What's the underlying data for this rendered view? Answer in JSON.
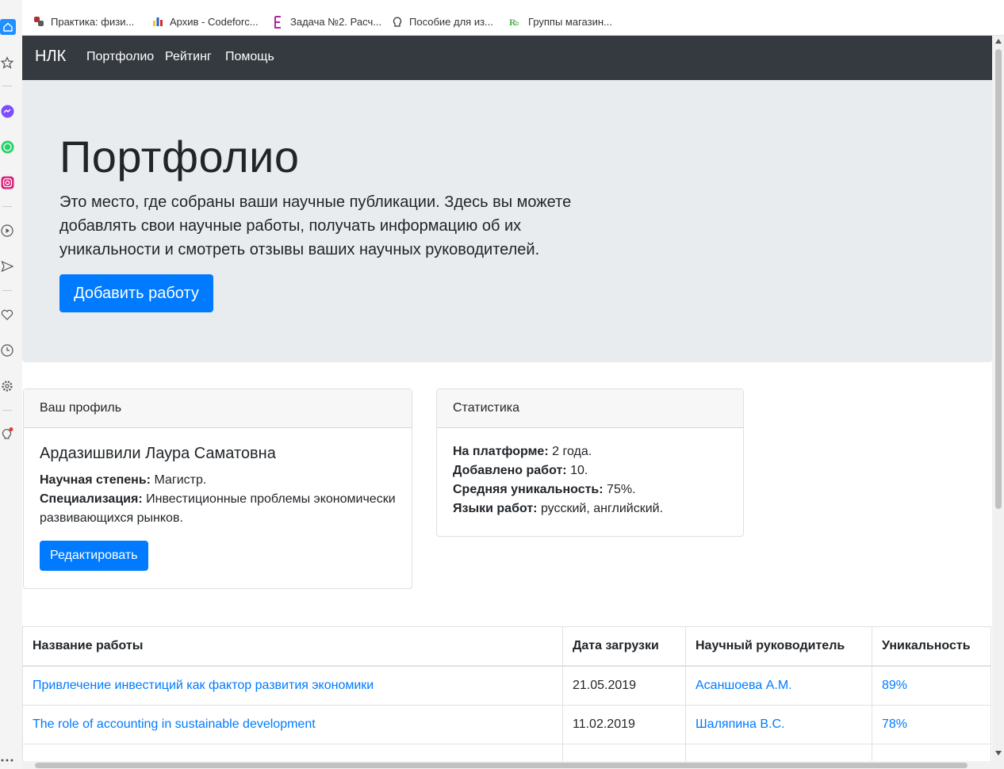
{
  "bookmarks": [
    {
      "label": "Практика: физи...",
      "icon": "python-icon"
    },
    {
      "label": "Архив - Codeforc...",
      "icon": "bar-chart-icon"
    },
    {
      "label": "Задача №2. Расч...",
      "icon": "letter-e-icon"
    },
    {
      "label": "Пособие для из...",
      "icon": "bulb-icon"
    },
    {
      "label": "Группы магазин...",
      "icon": "rb-icon"
    }
  ],
  "navbar": {
    "brand": "НЛК",
    "links": [
      "Портфолио",
      "Рейтинг",
      "Помощь"
    ]
  },
  "jumbotron": {
    "title": "Портфолио",
    "lead": "Это место, где собраны ваши научные публикации. Здесь вы можете добавлять свои научные работы, получать информацию об их уникальности и смотреть отзывы ваших научных руководителей.",
    "button": "Добавить работу"
  },
  "profile": {
    "header": "Ваш профиль",
    "name": "Ардазишвили Лаура Саматовна",
    "degree_label": "Научная степень:",
    "degree_value": "Магистр.",
    "spec_label": "Специализация:",
    "spec_value": "Инвестиционные проблемы экономически развивающихся рынков.",
    "edit_button": "Редактировать"
  },
  "stats": {
    "header": "Статистика",
    "rows": [
      {
        "label": "На платформе:",
        "value": "2 года."
      },
      {
        "label": "Добавлено работ:",
        "value": "10."
      },
      {
        "label": "Средняя уникальность:",
        "value": "75%."
      },
      {
        "label": "Языки работ:",
        "value": "русский, английский."
      }
    ]
  },
  "works_table": {
    "headers": [
      "Название работы",
      "Дата загрузки",
      "Научный руководитель",
      "Уникальность"
    ],
    "rows": [
      [
        "Привлечение инвестиций как фактор развития экономики",
        "21.05.2019",
        "Асаншоева А.М.",
        "89%"
      ],
      [
        "The role of accounting in sustainable development",
        "11.02.2019",
        "Шаляпина В.С.",
        "78%"
      ]
    ]
  },
  "colors": {
    "navbar": "#343a40",
    "jumbotron": "#e9ecef",
    "primary": "#007bff"
  }
}
